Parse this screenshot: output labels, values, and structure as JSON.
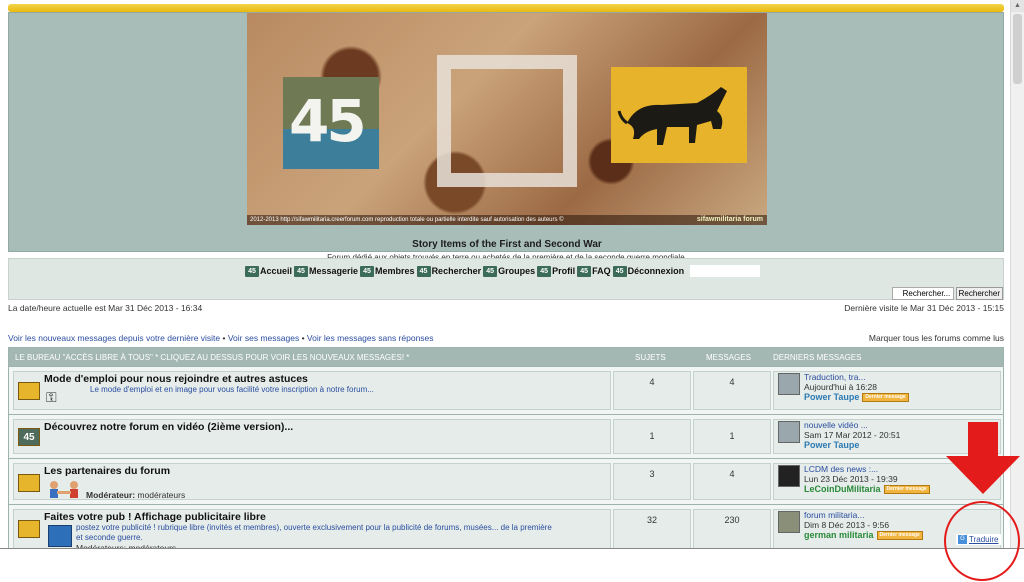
{
  "header": {
    "site_title": "Story Items of the First and Second War",
    "site_desc": "Forum dédié aux objets trouvés en terre ou achetés de la première et de la seconde guerre mondiale.",
    "banner_number": "45",
    "banner_caption": "2012-2013 http://sifawmilitaria.creerforum.com reproduction totale ou partielle interdite sauf autorisation des auteurs ©",
    "banner_brand": "sifawmilitaria forum"
  },
  "nav": {
    "icon_text": "45",
    "items": [
      "Accueil",
      "Messagerie",
      "Membres",
      "Rechercher",
      "Groupes",
      "Profil",
      "FAQ",
      "Déconnexion"
    ]
  },
  "search": {
    "value": "Rechercher...",
    "button": "Rechercher"
  },
  "info": {
    "datetime": "La date/heure actuelle est Mar 31 Déc 2013 - 16:34",
    "last_visit": "Dernière visite le Mar 31 Déc 2013 - 15:15",
    "link1": "Voir les nouveaux messages depuis votre dernière visite",
    "sep": " • ",
    "link2": "Voir ses messages",
    "link3": "Voir les messages sans réponses",
    "mark_read": "Marquer tous les forums comme lus"
  },
  "table": {
    "category": "LE BUREAU \"ACCÈS LIBRE À TOUS\" * CLIQUEZ AU DESSUS POUR VOIR LES NOUVEAUX MESSAGES! *",
    "col_sujets": "SUJETS",
    "col_messages": "MESSAGES",
    "col_last": "DERNIERS MESSAGES",
    "rows": [
      {
        "title": "Mode d'emploi pour nous rejoindre et autres astuces",
        "desc": "Le mode d'emploi et en image pour vous facilité votre inscription à notre forum...",
        "sujets": "4",
        "messages": "4",
        "last_title": "Traduction, tra...",
        "last_date": "Aujourd'hui à 16:28",
        "last_user": "Power Taupe",
        "user_color": "#2e7ab2"
      },
      {
        "title": "Découvrez notre forum en vidéo (2ième version)...",
        "sujets": "1",
        "messages": "1",
        "last_title": "nouvelle vidéo ...",
        "last_date": "Sam 17 Mar 2012 - 20:51",
        "last_user": "Power Taupe",
        "user_color": "#2e7ab2"
      },
      {
        "title": "Les partenaires du forum",
        "mod_label": "Modérateur:",
        "mod_value": "modérateurs",
        "sujets": "3",
        "messages": "4",
        "last_title": "LCDM des news :...",
        "last_date": "Lun 23 Déc 2013 - 19:39",
        "last_user": "LeCoinDuMilitaria",
        "user_color": "#2a8a3a"
      },
      {
        "title": "Faites votre pub ! Affichage publicitaire libre",
        "desc1": "postez votre publicité ! rubrique libre (invités et membres), ouverte exclusivement pour la publicité de forums, musées... de la première",
        "desc2": "et seconde guerre.",
        "mod_partial": "Modérateurs: modérateurs",
        "sujets": "32",
        "messages": "230",
        "last_title": "forum militaria...",
        "last_date": "Dim 8 Déc 2013 - 9:56",
        "last_user": "german militaria",
        "user_color": "#2a8a3a"
      }
    ],
    "badge_text": "Dernier message"
  },
  "overlay": {
    "translate_label": "Traduire",
    "arrow_color": "#e41b1b"
  }
}
